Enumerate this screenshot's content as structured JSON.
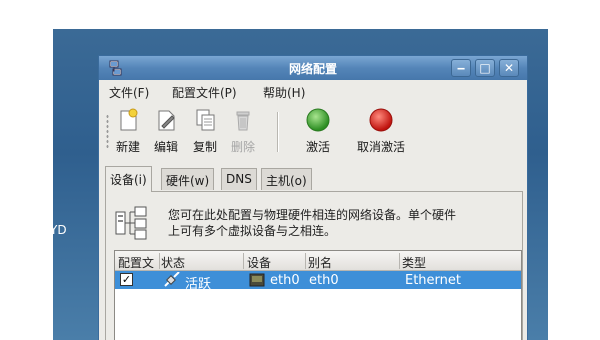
{
  "desktop": {
    "partial_text": "YD"
  },
  "window": {
    "title": "网络配置",
    "controls": {
      "minimize": "‒",
      "maximize": "□",
      "close": "✕"
    }
  },
  "menu": [
    {
      "label": "文件(F)"
    },
    {
      "label": "配置文件(P)"
    },
    {
      "label": "帮助(H)"
    }
  ],
  "toolbar": {
    "new": "新建",
    "edit": "编辑",
    "copy": "复制",
    "delete": "删除",
    "activate": "激活",
    "deactivate": "取消激活"
  },
  "tabs": [
    {
      "label": "设备(i)",
      "active": true
    },
    {
      "label": "硬件(w)",
      "active": false
    },
    {
      "label": "DNS",
      "active": false
    },
    {
      "label": "主机(o)",
      "active": false
    }
  ],
  "info": {
    "line1": "您可在此处配置与物理硬件相连的网络设备。单个硬件",
    "line2": "上可有多个虚拟设备与之相连。"
  },
  "table": {
    "headers": [
      "配置文",
      "状态",
      "设备",
      "别名",
      "类型"
    ],
    "rows": [
      {
        "profile_checked": "✓",
        "status": "活跃",
        "device": "eth0",
        "alias": "eth0",
        "type": "Ethernet"
      }
    ]
  },
  "colors": {
    "activate_icon": "#3aa83a",
    "deactivate_icon": "#d21e1e",
    "selection": "#3e8fd8"
  }
}
